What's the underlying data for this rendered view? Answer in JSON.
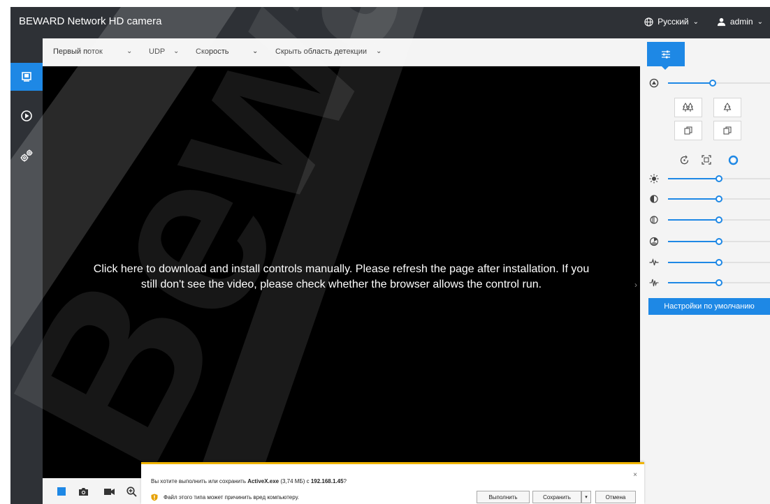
{
  "header": {
    "title": "BEWARD Network HD camera",
    "language": "Русский",
    "user": "admin"
  },
  "toolbar": {
    "stream": "Первый поток",
    "protocol": "UDP",
    "speed": "Скорость",
    "detection": "Скрыть область детекции"
  },
  "video": {
    "message_line1": "Click here to download and install controls manually. Please refresh the page after installation. If you",
    "message_line2": "still don't see the video, please check whether the browser allows the control run."
  },
  "image_panel": {
    "sliders": [
      {
        "icon": "zoom-speed-icon",
        "value": 0.44
      },
      {
        "icon": "brightness-icon",
        "value": 0.5
      },
      {
        "icon": "contrast-icon",
        "value": 0.5
      },
      {
        "icon": "saturation-icon",
        "value": 0.5
      },
      {
        "icon": "hue-icon",
        "value": 0.5
      },
      {
        "icon": "sharpness-icon",
        "value": 0.5
      },
      {
        "icon": "noise-reduction-icon",
        "value": 0.5
      }
    ],
    "default_button": "Настройки по умолчанию"
  },
  "download_dialog": {
    "question_prefix": "Вы хотите выполнить или сохранить ",
    "file_name": "ActiveX.exe",
    "file_size": " (3,74 МБ) с ",
    "host": "192.168.1.45",
    "question_suffix": "?",
    "warning": "Файл этого типа может причинить вред компьютеру.",
    "run_label": "Выполнить",
    "save_label": "Сохранить",
    "cancel_label": "Отмена",
    "close_glyph": "×",
    "caret_glyph": "▾"
  },
  "watermark": {
    "text": "Bewa"
  },
  "colors": {
    "accent": "#1e88e5",
    "header_bg": "#2e3136",
    "panel_bg": "#f4f4f4",
    "dialog_border": "#f0b400"
  }
}
